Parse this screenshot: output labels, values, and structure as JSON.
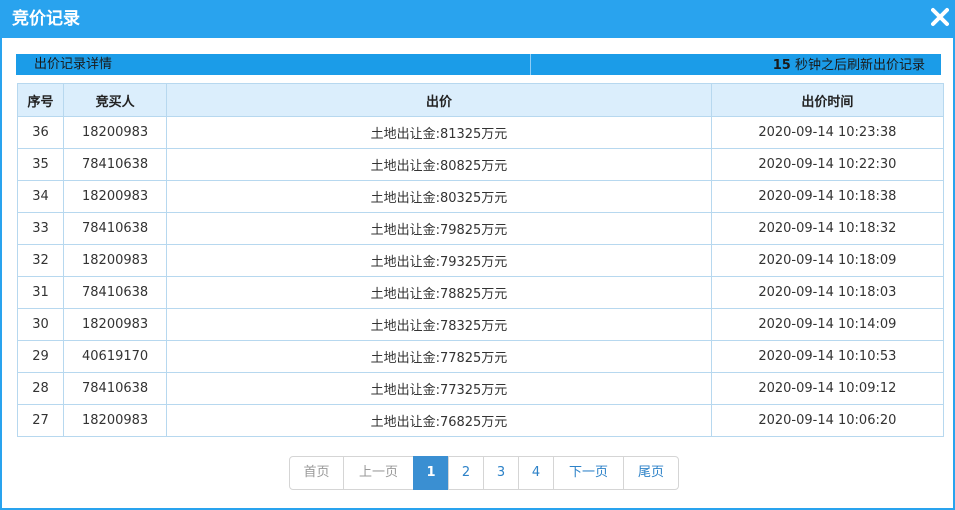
{
  "dialog": {
    "title": "竞价记录"
  },
  "info": {
    "left": "出价记录详情",
    "refresh_seconds": "15",
    "refresh_text": " 秒钟之后刷新出价记录"
  },
  "table": {
    "headers": [
      "序号",
      "竞买人",
      "出价",
      "出价时间"
    ],
    "rows": [
      {
        "no": "36",
        "bidder": "18200983",
        "price": "土地出让金:81325万元",
        "time": "2020-09-14 10:23:38"
      },
      {
        "no": "35",
        "bidder": "78410638",
        "price": "土地出让金:80825万元",
        "time": "2020-09-14 10:22:30"
      },
      {
        "no": "34",
        "bidder": "18200983",
        "price": "土地出让金:80325万元",
        "time": "2020-09-14 10:18:38"
      },
      {
        "no": "33",
        "bidder": "78410638",
        "price": "土地出让金:79825万元",
        "time": "2020-09-14 10:18:32"
      },
      {
        "no": "32",
        "bidder": "18200983",
        "price": "土地出让金:79325万元",
        "time": "2020-09-14 10:18:09"
      },
      {
        "no": "31",
        "bidder": "78410638",
        "price": "土地出让金:78825万元",
        "time": "2020-09-14 10:18:03"
      },
      {
        "no": "30",
        "bidder": "18200983",
        "price": "土地出让金:78325万元",
        "time": "2020-09-14 10:14:09"
      },
      {
        "no": "29",
        "bidder": "40619170",
        "price": "土地出让金:77825万元",
        "time": "2020-09-14 10:10:53"
      },
      {
        "no": "28",
        "bidder": "78410638",
        "price": "土地出让金:77325万元",
        "time": "2020-09-14 10:09:12"
      },
      {
        "no": "27",
        "bidder": "18200983",
        "price": "土地出让金:76825万元",
        "time": "2020-09-14 10:06:20"
      }
    ]
  },
  "pager": {
    "first": "首页",
    "prev": "上一页",
    "pages": [
      "1",
      "2",
      "3",
      "4"
    ],
    "current_page": "1",
    "next": "下一页",
    "last": "尾页"
  },
  "icons": {
    "close": "close-icon"
  },
  "colors": {
    "titlebar": "#29a3ee",
    "info_bar": "#1b9ce8",
    "header_bg": "#dbeefc",
    "active_page": "#3a8fd2"
  }
}
